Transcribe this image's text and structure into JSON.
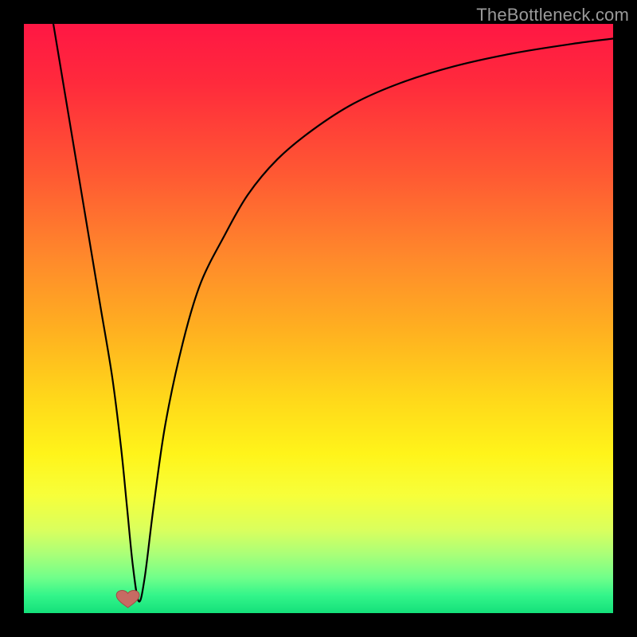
{
  "watermark": {
    "text": "TheBottleneck.com"
  },
  "gradient": {
    "stops": [
      {
        "offset": 0,
        "color": "#ff1744"
      },
      {
        "offset": 10,
        "color": "#ff2a3c"
      },
      {
        "offset": 25,
        "color": "#ff5733"
      },
      {
        "offset": 40,
        "color": "#ff8a2b"
      },
      {
        "offset": 52,
        "color": "#ffb020"
      },
      {
        "offset": 64,
        "color": "#ffd91a"
      },
      {
        "offset": 73,
        "color": "#fff41a"
      },
      {
        "offset": 80,
        "color": "#f7ff3a"
      },
      {
        "offset": 86,
        "color": "#d9ff5e"
      },
      {
        "offset": 90,
        "color": "#aaff78"
      },
      {
        "offset": 94,
        "color": "#70ff8a"
      },
      {
        "offset": 97,
        "color": "#33f58a"
      },
      {
        "offset": 100,
        "color": "#14e07a"
      }
    ]
  },
  "chart_data": {
    "type": "line",
    "title": "",
    "xlabel": "",
    "ylabel": "",
    "x_range": [
      0,
      100
    ],
    "y_range": [
      0,
      100
    ],
    "series": [
      {
        "name": "curve",
        "color": "#000000",
        "x": [
          5,
          7,
          9,
          11,
          13,
          15,
          16.5,
          17.5,
          18.5,
          19.5,
          20.5,
          22,
          24,
          27,
          30,
          34,
          38,
          43,
          49,
          56,
          64,
          73,
          83,
          93,
          100
        ],
        "values": [
          100,
          88,
          76,
          64,
          52,
          40,
          28,
          18,
          8,
          2,
          6,
          18,
          32,
          46,
          56,
          64,
          71,
          77,
          82,
          86.5,
          90,
          92.8,
          95,
          96.6,
          97.5
        ]
      }
    ],
    "annotations": {
      "dip_marker": {
        "x": 19,
        "y": 2,
        "shape": "heart",
        "color": "#c76b63"
      }
    }
  }
}
